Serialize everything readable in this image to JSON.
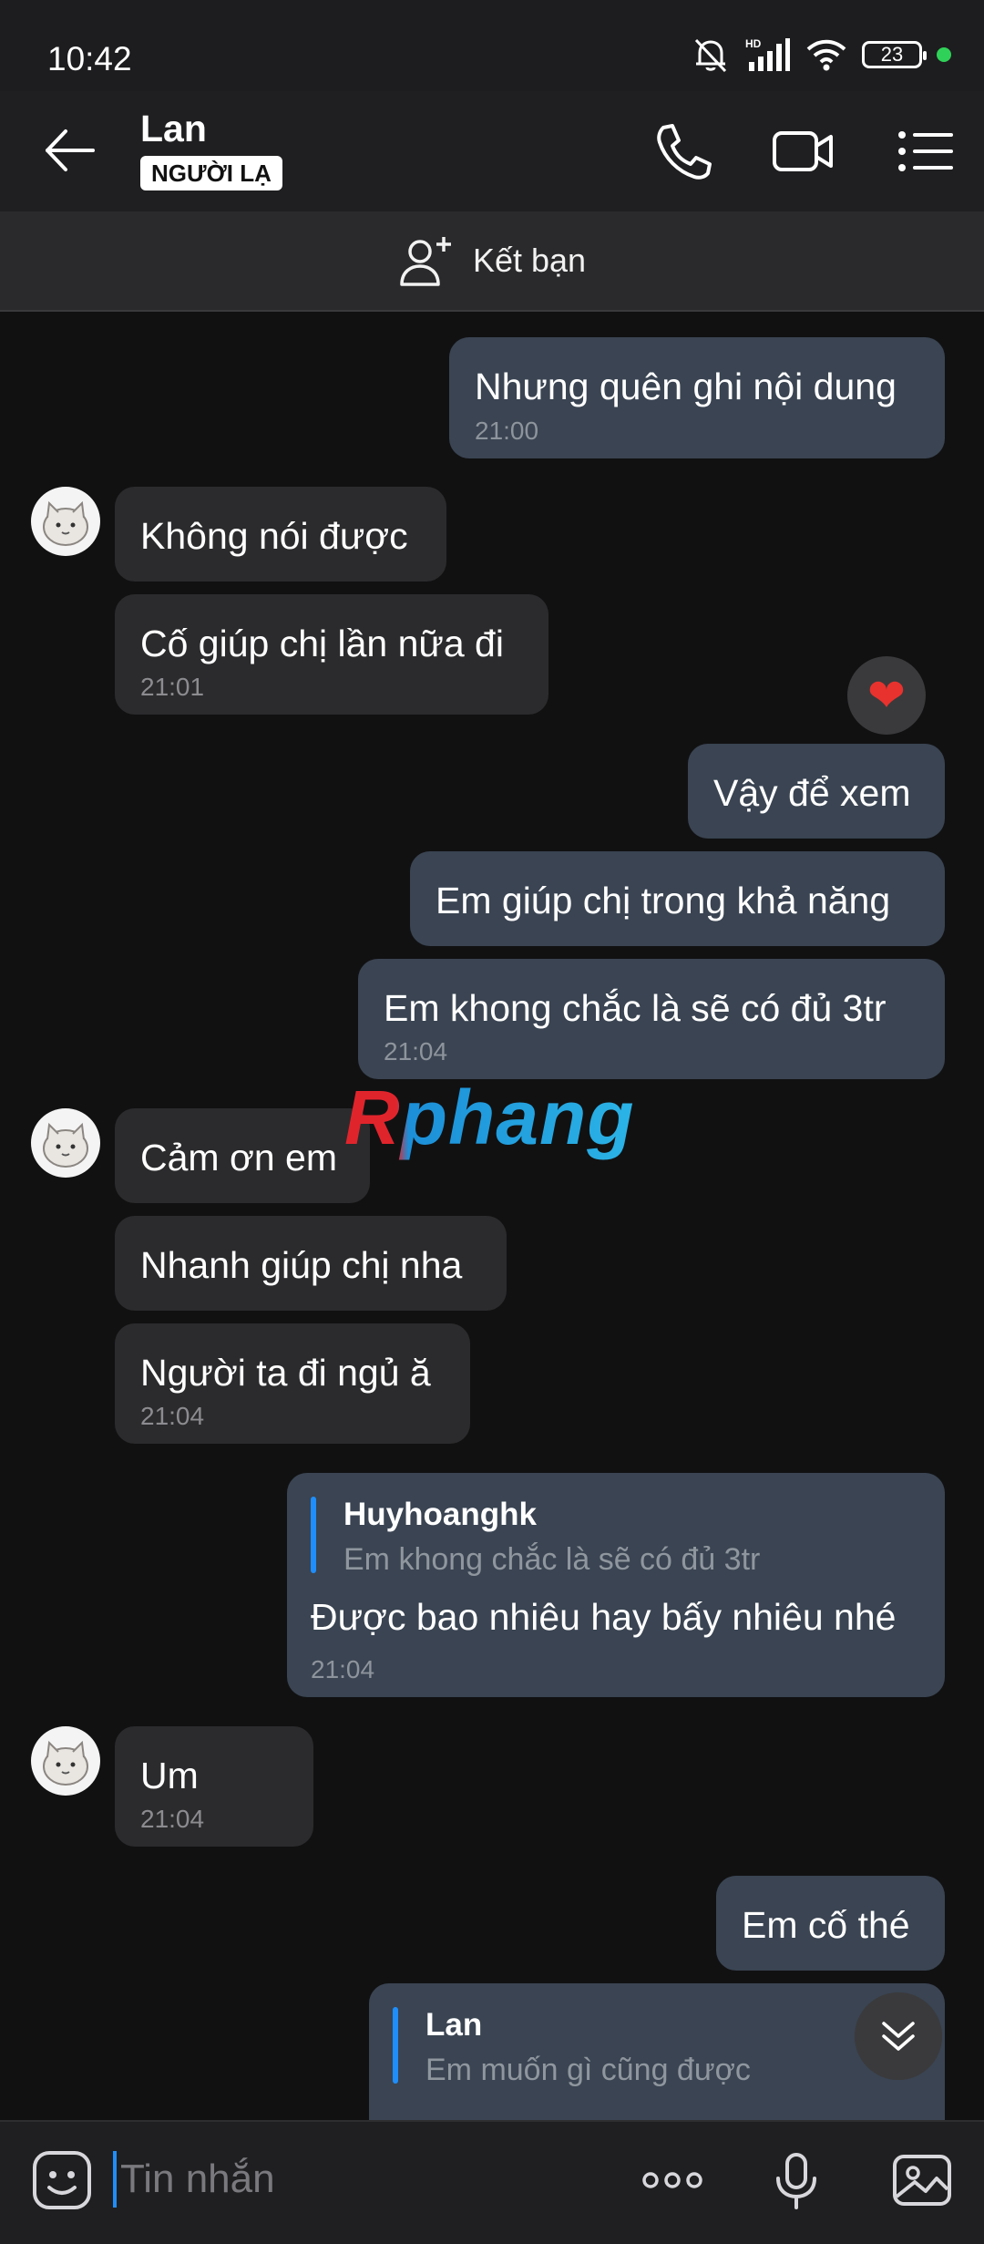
{
  "status_bar": {
    "time": "10:42",
    "battery": "23",
    "network": "HD"
  },
  "header": {
    "contact_name": "Lan",
    "badge": "NGƯỜI LẠ",
    "icons": [
      "back-arrow-icon",
      "phone-icon",
      "video-camera-icon",
      "menu-list-icon"
    ]
  },
  "friend_bar": {
    "label": "Kết bạn"
  },
  "messages": [
    {
      "dir": "out",
      "text": "Nhưng quên ghi nội dung",
      "time": "21:00"
    },
    {
      "dir": "in",
      "text": "Không nói được"
    },
    {
      "dir": "in",
      "text": "Cố giúp chị lần nữa đi",
      "time": "21:01"
    },
    {
      "dir": "out",
      "text": "Vậy để xem",
      "reaction": "heart"
    },
    {
      "dir": "out",
      "text": "Em giúp chị trong khả năng"
    },
    {
      "dir": "out",
      "text": "Em khong chắc là sẽ có đủ 3tr",
      "time": "21:04"
    },
    {
      "dir": "in",
      "text": "Cảm ơn em"
    },
    {
      "dir": "in",
      "text": "Nhanh giúp chị nha"
    },
    {
      "dir": "in",
      "text": "Người ta đi ngủ ă",
      "time": "21:04"
    },
    {
      "dir": "out",
      "quote": {
        "name": "Huyhoanghk",
        "text": "Em khong chắc là sẽ có đủ 3tr"
      },
      "text": "Được bao nhiêu hay bấy nhiêu nhé",
      "time": "21:04"
    },
    {
      "dir": "in",
      "text": "Um",
      "time": "21:04"
    },
    {
      "dir": "out",
      "text": "Em cố thé"
    },
    {
      "dir": "out",
      "quote": {
        "name": "Lan",
        "text": "Em muốn gì cũng được"
      }
    }
  ],
  "watermark": "Rphang",
  "input": {
    "placeholder": "Tin nhắn"
  },
  "colors": {
    "background": "#111112",
    "outgoing_bubble": "#3a4452",
    "incoming_bubble": "#2b2b2d",
    "accent": "#1f8efa"
  }
}
